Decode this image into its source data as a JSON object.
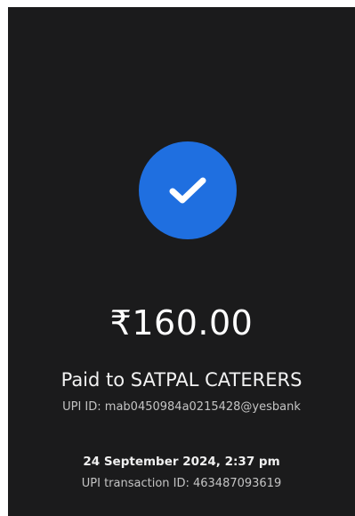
{
  "payment": {
    "status_icon": "check-icon",
    "accent_color": "#1f6fe0",
    "amount": "₹160.00",
    "paid_to": "Paid to SATPAL CATERERS",
    "upi_id": "UPI ID: mab0450984a0215428@yesbank",
    "datetime": "24 September 2024, 2:37 pm",
    "transaction_id": "UPI transaction ID: 463487093619"
  }
}
